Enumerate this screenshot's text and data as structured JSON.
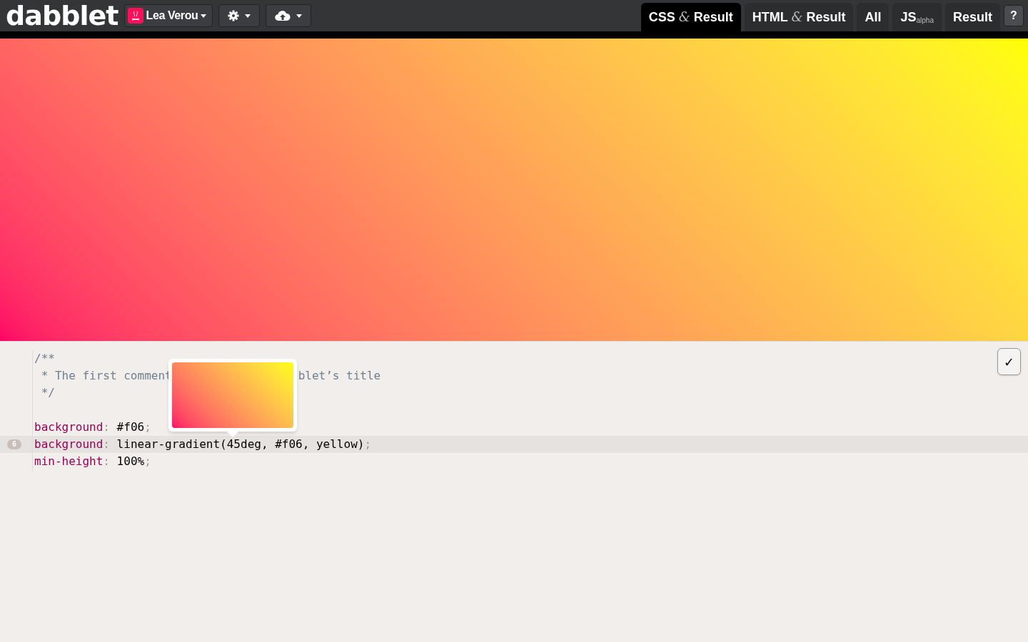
{
  "header": {
    "logo": "dabblet",
    "user": {
      "name": "Lea Verou"
    },
    "menus": [
      {
        "kind": "settings"
      },
      {
        "kind": "cloud"
      }
    ]
  },
  "tabs": [
    {
      "label": "CSS *&* Result",
      "selected": true
    },
    {
      "label": "HTML *&* Result",
      "selected": false
    },
    {
      "label": "All",
      "selected": false
    },
    {
      "label": "JS$_{alpha}$",
      "selected": false
    },
    {
      "label": "Result",
      "selected": false
    }
  ],
  "help_button": "?",
  "editor": {
    "lines": [
      {
        "kind": "comment",
        "segments": [
          "/**"
        ]
      },
      {
        "kind": "comment",
        "segments": [
          " * The first comment",
          "blet’s title"
        ]
      },
      {
        "kind": "comment",
        "segments": [
          " */"
        ]
      },
      {
        "kind": "blank"
      },
      {
        "kind": "code",
        "property": "background",
        "value": "#f06",
        "selected": false
      },
      {
        "kind": "code",
        "property": "background",
        "value": "linear-gradient(45deg, #f06, yellow)",
        "selected": true,
        "number": "6"
      },
      {
        "kind": "code",
        "property": "min-height",
        "value": "100%",
        "selected": false
      }
    ],
    "punctuation": {
      "colon": ":",
      "semicolon": ";"
    },
    "confirm_button": "✓"
  }
}
